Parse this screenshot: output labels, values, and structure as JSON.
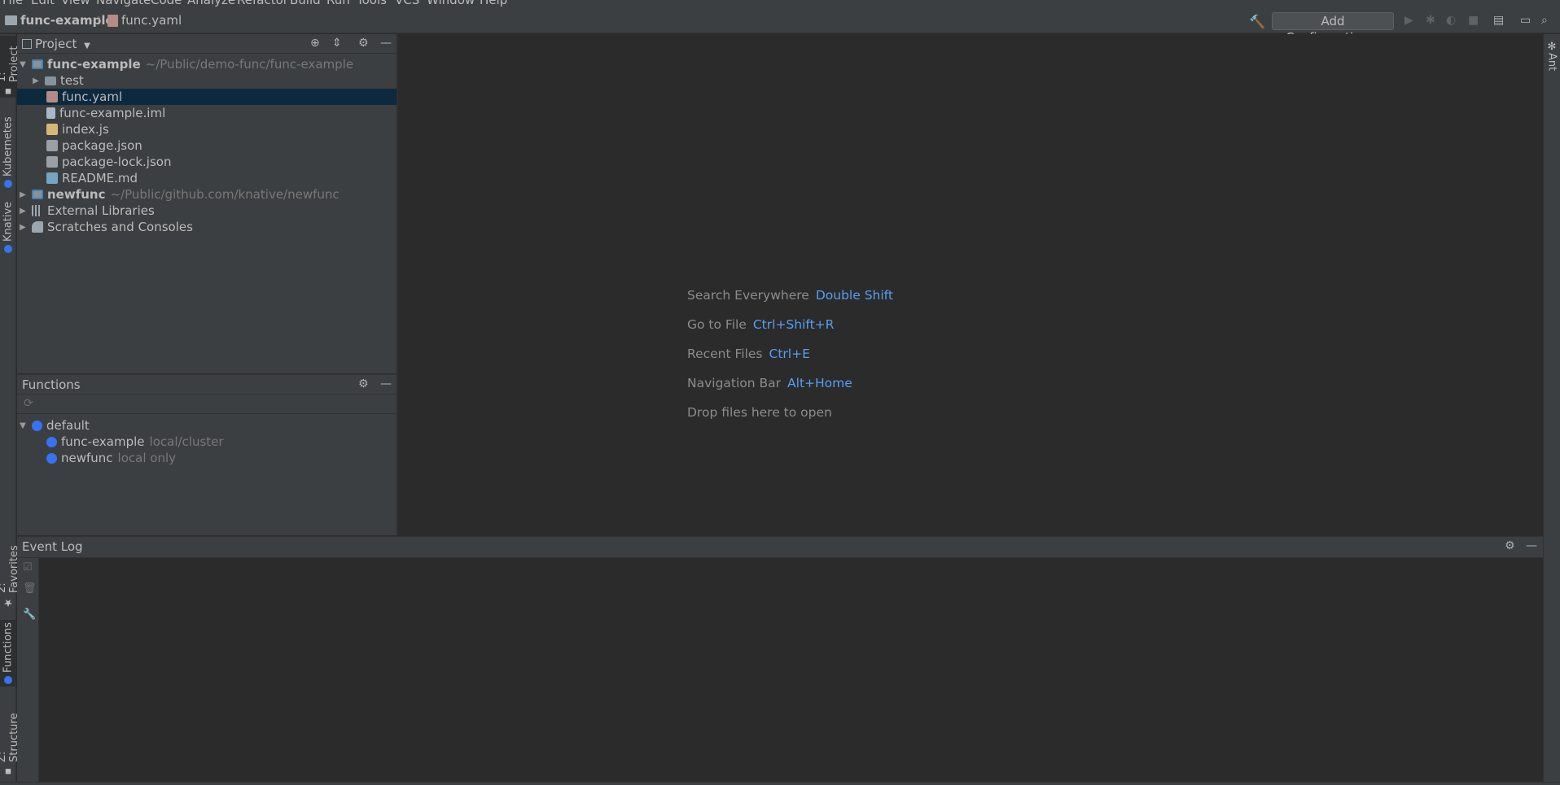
{
  "menu": {
    "items": [
      "File",
      "Edit",
      "View",
      "Navigate",
      "Code",
      "Analyze",
      "Refactor",
      "Build",
      "Run",
      "Tools",
      "VCS",
      "Window",
      "Help"
    ]
  },
  "breadcrumb": {
    "project": "func-example",
    "file": "func.yaml"
  },
  "toolbar": {
    "add_config_label": "Add Configuration..."
  },
  "left_tabs": {
    "project": "1: Project",
    "kubernetes": "Kubernetes",
    "knative": "Knative",
    "favorites": "2: Favorites",
    "functions": "Functions",
    "structure": "Z: Structure"
  },
  "right_tabs": {
    "ant": "Ant"
  },
  "project_panel": {
    "title": "Project",
    "tree": [
      {
        "label": "func-example",
        "path": "~/Public/demo-func/func-example"
      },
      {
        "label": "test"
      },
      {
        "label": "func.yaml"
      },
      {
        "label": "func-example.iml"
      },
      {
        "label": "index.js"
      },
      {
        "label": "package.json"
      },
      {
        "label": "package-lock.json"
      },
      {
        "label": "README.md"
      },
      {
        "label": "newfunc",
        "path": "~/Public/github.com/knative/newfunc"
      },
      {
        "label": "External Libraries"
      },
      {
        "label": "Scratches and Consoles"
      }
    ]
  },
  "functions_panel": {
    "title": "Functions",
    "tree": [
      {
        "label": "default"
      },
      {
        "label": "func-example",
        "status": "local/cluster"
      },
      {
        "label": "newfunc",
        "status": "local only"
      }
    ]
  },
  "editor": {
    "hints": [
      {
        "label": "Search Everywhere",
        "key": "Double Shift"
      },
      {
        "label": "Go to File",
        "key": "Ctrl+Shift+R"
      },
      {
        "label": "Recent Files",
        "key": "Ctrl+E"
      },
      {
        "label": "Navigation Bar",
        "key": "Alt+Home"
      },
      {
        "label": "Drop files here to open",
        "key": ""
      }
    ]
  },
  "event_log": {
    "title": "Event Log"
  }
}
